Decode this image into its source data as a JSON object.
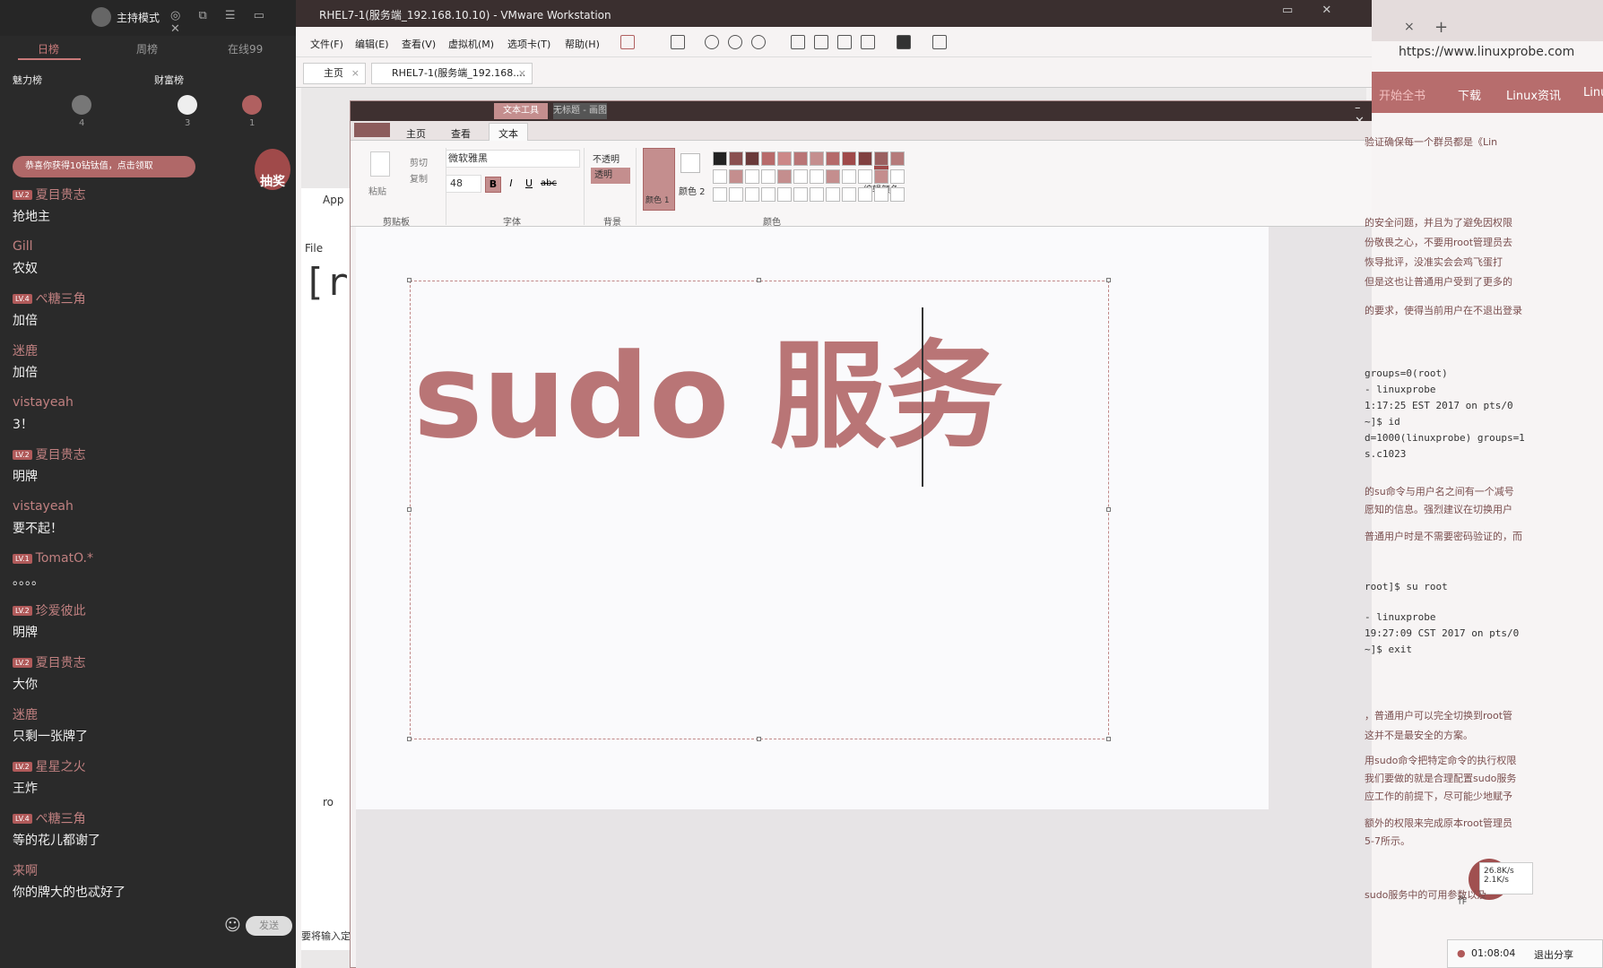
{
  "chat": {
    "mode_label": "主持模式",
    "tabs": [
      "日榜",
      "周榜",
      "在线99"
    ],
    "rank_left": "魅力榜",
    "rank_right": "财富榜",
    "rank_numbers": [
      "4",
      "3",
      "1"
    ],
    "lottery_banner": "恭喜你获得10钻钛值，点击领取",
    "draw_label": "抽奖",
    "messages": [
      {
        "user": "夏目贵志",
        "level": "LV.2",
        "text": "抢地主"
      },
      {
        "user": "Gill",
        "level": "",
        "text": "农奴"
      },
      {
        "user": "ぺ糖三角",
        "level": "LV.4",
        "text": "加倍"
      },
      {
        "user": "迷鹿",
        "level": "",
        "text": "加倍"
      },
      {
        "user": "vistayeah",
        "level": "",
        "text": "3！"
      },
      {
        "user": "夏目贵志",
        "level": "LV.2",
        "text": "明牌"
      },
      {
        "user": "vistayeah",
        "level": "",
        "text": "要不起！"
      },
      {
        "user": "TomatO.*",
        "level": "LV.1",
        "text": "。。。。"
      },
      {
        "user": "珍爱彼此",
        "level": "LV.2",
        "text": "明牌"
      },
      {
        "user": "夏目贵志",
        "level": "LV.2",
        "text": "大你"
      },
      {
        "user": "迷鹿",
        "level": "",
        "text": "只剩一张牌了"
      },
      {
        "user": "星星之火",
        "level": "LV.2",
        "text": "王炸"
      },
      {
        "user": "ぺ糖三角",
        "level": "LV.4",
        "text": "等的花儿都谢了"
      },
      {
        "user": "来啊",
        "level": "",
        "text": "你的牌大的也忒好了"
      }
    ],
    "send_label": "发送"
  },
  "vmware": {
    "title": "RHEL7-1(服务端_192.168.10.10) - VMware Workstation",
    "menu": [
      "文件(F)",
      "编辑(E)",
      "查看(V)",
      "虚拟机(M)",
      "选项卡(T)",
      "帮助(H)"
    ],
    "tabs": [
      "主页",
      "RHEL7-1(服务端_192.168...."
    ],
    "guest_app_label": "App",
    "guest_file_label": "File",
    "guest_prompt": "[r",
    "guest_status": "要将输入定",
    "guest_task": "ro"
  },
  "paint": {
    "context_tabs": [
      "文本工具",
      "无标题 - 画图"
    ],
    "ribbon_tabs": [
      "主页",
      "查看",
      "文本"
    ],
    "clipboard": {
      "paste": "粘贴",
      "cut": "剪切",
      "copy": "复制",
      "group": "剪贴板"
    },
    "font": {
      "name": "微软雅黑",
      "size": "48",
      "group": "字体",
      "bold": "B",
      "italic": "I",
      "underline": "U",
      "strike": "abc"
    },
    "background": {
      "opaque": "不透明",
      "transparent": "透明",
      "group": "背景"
    },
    "colors": {
      "color1": "颜色 1",
      "color2": "颜色 2",
      "edit": "编辑颜色",
      "group": "颜色"
    },
    "canvas_text": "sudo 服务"
  },
  "browser": {
    "url": "https://www.linuxprobe.com",
    "nav": [
      "开始全书",
      "下载",
      "Linux资讯",
      "Linu"
    ],
    "texts": [
      "验证确保每一个群员都是《Lin",
      "的安全问题，并且为了避免因权限",
      "份敬畏之心，不要用root管理员去",
      "恢导批评，没准实会会鸡飞蛋打",
      "但是这也让普通用户受到了更多的",
      "的要求，使得当前用户在不退出登录",
      "的su命令与用户名之间有一个减号",
      "愿知的信息。强烈建议在切换用户",
      "普通用户时是不需要密码验证的，而",
      "，普通用户可以完全切换到root管",
      "这并不是最安全的方案。",
      "用sudo命令把特定命令的执行权限",
      "我们要做的就是合理配置sudo服务",
      "应工作的前提下，尽可能少地赋予",
      "额外的权限来完成原本root管理员",
      "5-7所示。",
      "sudo服务中的可用参数以及"
    ],
    "terminal": [
      "groups=0(root)",
      "- linuxprobe",
      "1:17:25 EST 2017 on pts/0",
      "~]$ id",
      "d=1000(linuxprobe) groups=1",
      "s.c1023",
      "root]$ su root",
      "- linuxprobe",
      "19:27:09 CST 2017 on pts/0",
      "~]$ exit"
    ],
    "speed_up": "26.8K/s",
    "speed_down": "2.1K/s",
    "timer": "01:08:04",
    "exit_share": "退出分享",
    "speed_prefix": "作"
  }
}
